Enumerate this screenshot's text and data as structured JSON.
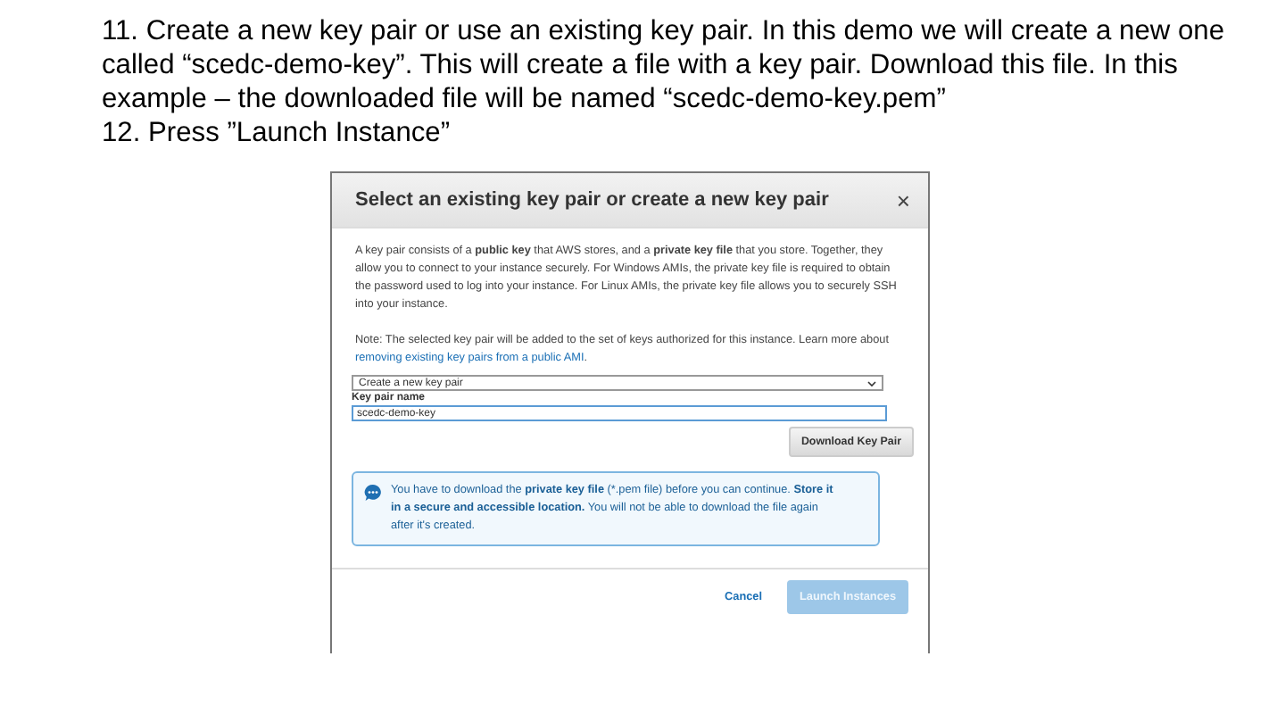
{
  "instructions": [
    {
      "text": "11. Create a new key pair or use an existing key pair. In this demo we will create a new one called “scedc-demo-key”.  This will create a file with a key pair. Download this file.  In this example – the downloaded file will be named “scedc-demo-key.pem”"
    },
    {
      "text": "12. Press ”Launch Instance”"
    }
  ],
  "dialog": {
    "title": "Select an existing key pair or create a new key pair",
    "close": "×",
    "description": "A key pair consists of a **public key** that AWS stores, and a **private key file** that you store. Together, they allow you to connect to your instance securely. For Windows AMIs, the private key file is required to obtain the password used to log into your instance. For Linux AMIs, the private key file allows you to securely SSH into your instance.",
    "note": "Note: The selected key pair will be added to the set of keys authorized for this instance. Learn more about",
    "note_link": "removing existing key pairs from a public AMI",
    "note_end": ".",
    "select": {
      "value": "Create a new key pair"
    },
    "name_field": {
      "label": "Key pair name",
      "value": "scedc-demo-key"
    },
    "download_button": "Download Key Pair",
    "info": "You have to download the **private key file** (*.pem file) before you can continue. **Store it in a secure and accessible location.** You will not be able to download the file again after it's created.",
    "buttons": [
      {
        "label": "Cancel",
        "kind": "link"
      },
      {
        "label": "Launch Instances",
        "kind": "primary",
        "disabled": true
      }
    ]
  }
}
